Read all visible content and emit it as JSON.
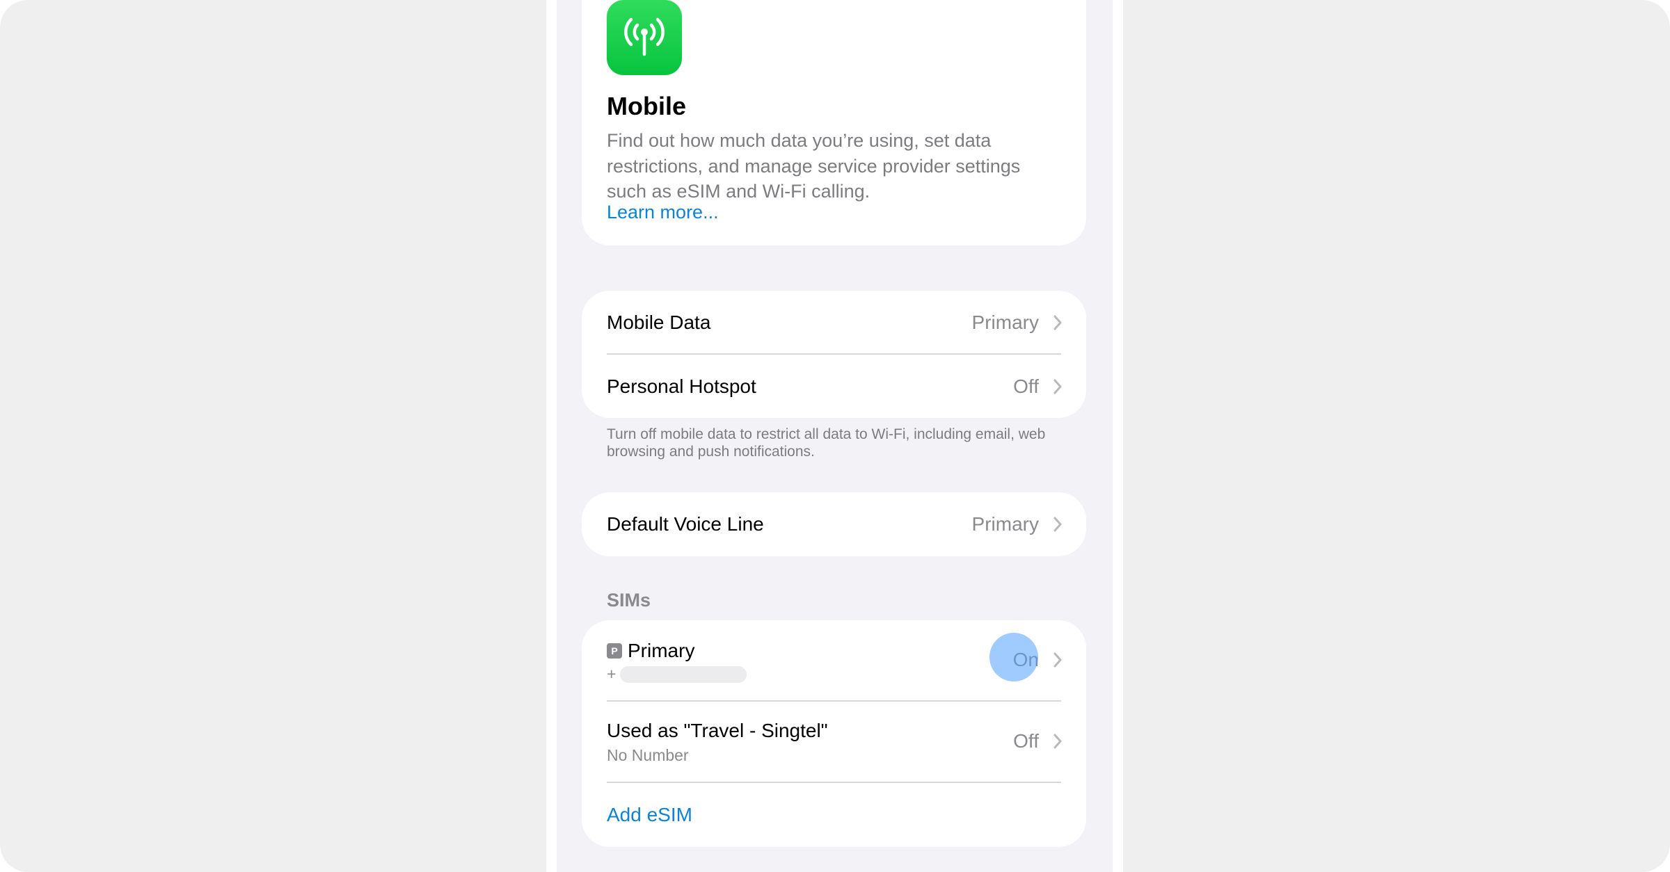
{
  "hero": {
    "icon": "antenna-signal-icon",
    "icon_color": "#11cc4a",
    "title": "Mobile",
    "description": "Find out how much data you’re using, set data restrictions, and manage service provider settings such as eSIM and Wi-Fi calling.",
    "learn_more": "Learn more..."
  },
  "data_group": {
    "rows": [
      {
        "label": "Mobile Data",
        "value": "Primary"
      },
      {
        "label": "Personal Hotspot",
        "value": "Off"
      }
    ],
    "footnote": "Turn off mobile data to restrict all data to Wi-Fi, including email, web browsing and push notifications."
  },
  "voice_group": {
    "label": "Default Voice Line",
    "value": "Primary"
  },
  "sims": {
    "header": "SIMs",
    "primary": {
      "badge": "P",
      "title": "Primary",
      "number_prefix": "+",
      "value": "On"
    },
    "travel": {
      "title": "Used as \"Travel - Singtel\"",
      "subtitle": "No Number",
      "value": "Off"
    },
    "add_esim": "Add eSIM"
  },
  "colors": {
    "accent_blue": "#0a84d6",
    "secondary_text": "#8a8a8e",
    "background": "#f2f2f7"
  }
}
